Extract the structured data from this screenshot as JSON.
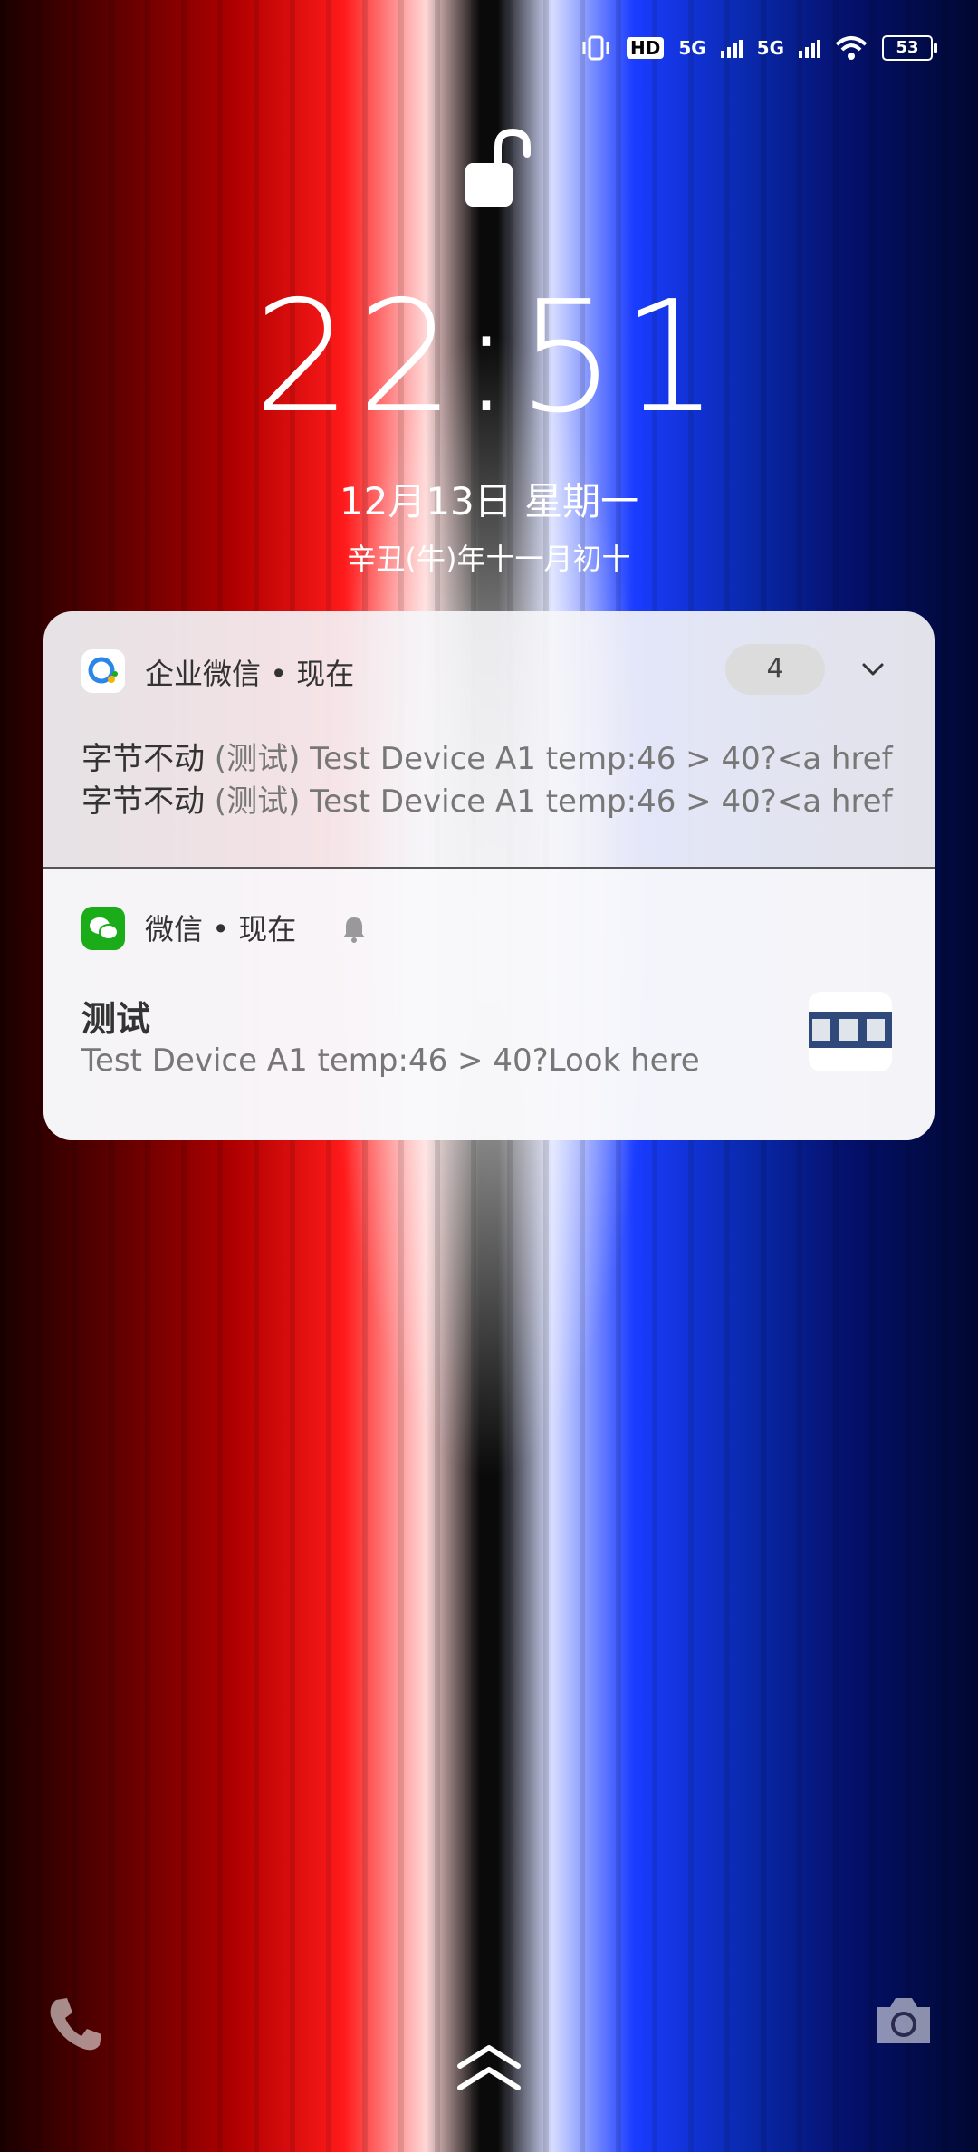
{
  "status_bar": {
    "hd_label": "HD",
    "net1": "5G",
    "net2": "5G",
    "battery": "53"
  },
  "lock": {
    "time": "22:51",
    "date": "12月13日  星期一",
    "lunar": "辛丑(牛)年十一月初十"
  },
  "notifications": [
    {
      "app_name": "企业微信",
      "separator": " • ",
      "time": "现在",
      "badge": "4",
      "lines": [
        {
          "sender": "字节不动",
          "text": " (测试) Test Device A1 temp:46 > 40?<a href"
        },
        {
          "sender": "字节不动",
          "text": " (测试) Test Device A1 temp:46 > 40?<a href"
        }
      ]
    },
    {
      "app_name": "微信",
      "separator": " • ",
      "time": "现在",
      "title": "测试",
      "body": "Test Device A1 temp:46 > 40?Look here"
    }
  ],
  "icons": {
    "phone": "phone-icon",
    "swipe_up": "chevron-up-icon",
    "camera": "camera-icon",
    "lock": "unlock-icon"
  }
}
